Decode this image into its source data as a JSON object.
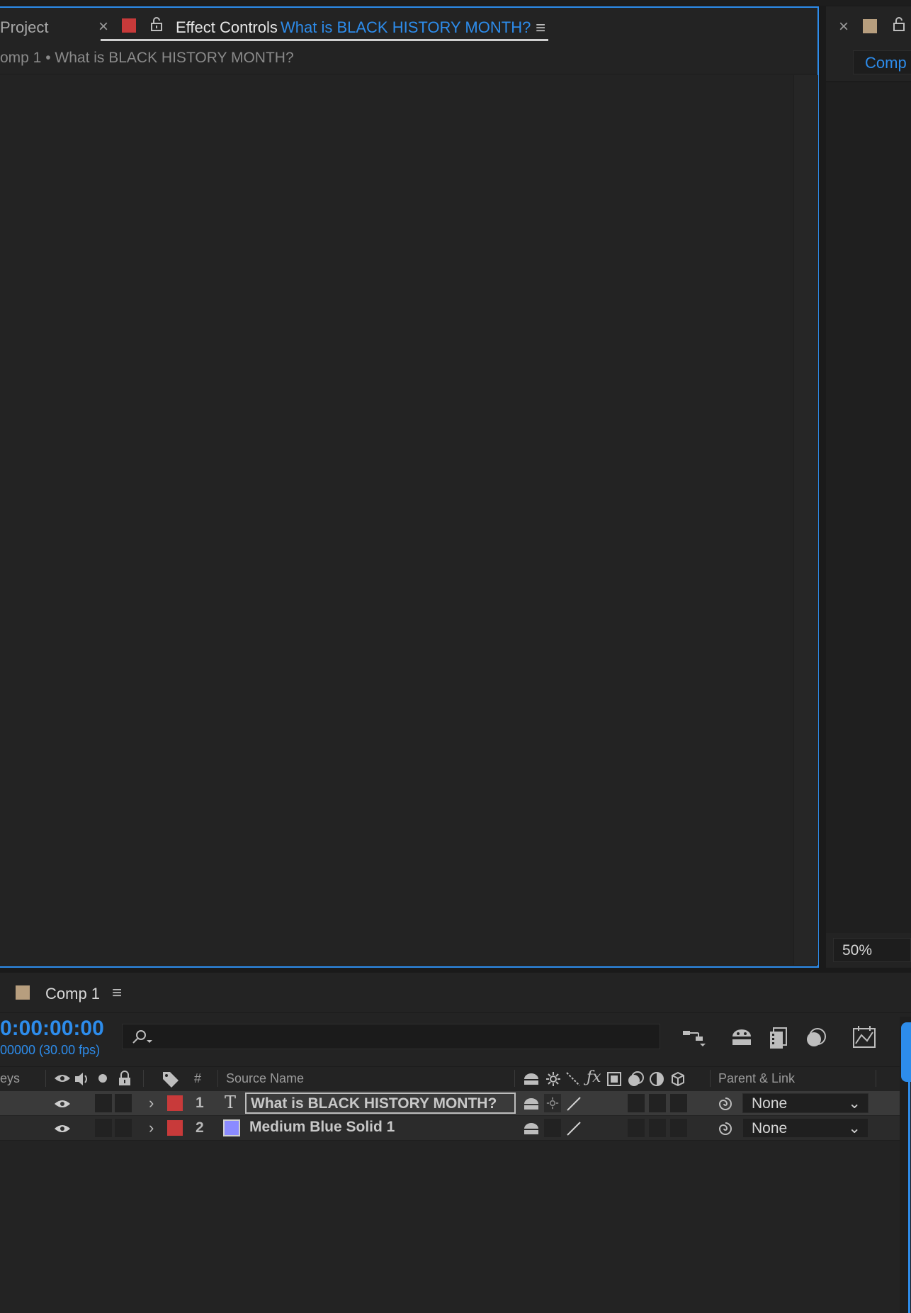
{
  "top_tabs": {
    "project_label": "Project",
    "effect_controls_label": "Effect Controls",
    "effect_controls_target": "What is  BLACK HISTORY MONTH?",
    "close_glyph": "×",
    "menu_glyph": "≡"
  },
  "effect_controls": {
    "subtitle": "omp 1 • What is  BLACK HISTORY MONTH?"
  },
  "comp_viewer": {
    "close_glyph": "×",
    "tab_label": "Comp",
    "zoom": "50%"
  },
  "timeline": {
    "comp_tab_label": "Comp 1",
    "timecode": "0:00:00:00",
    "frame_info": "00000 (30.00 fps)",
    "columns": {
      "keys": "eys",
      "number": "#",
      "source_name": "Source Name",
      "parent_link": "Parent & Link"
    },
    "layers": [
      {
        "number": "1",
        "type_glyph": "T",
        "name": "What is  BLACK HISTORY MONTH?",
        "parent": "None"
      },
      {
        "number": "2",
        "type_glyph": "",
        "name": "Medium Blue Solid 1",
        "parent": "None"
      }
    ]
  },
  "colors": {
    "accent": "#2d8ceb",
    "label_red": "#c83a3a",
    "label_tan": "#b79e7e",
    "solid_swatch": "#8b8bff"
  }
}
